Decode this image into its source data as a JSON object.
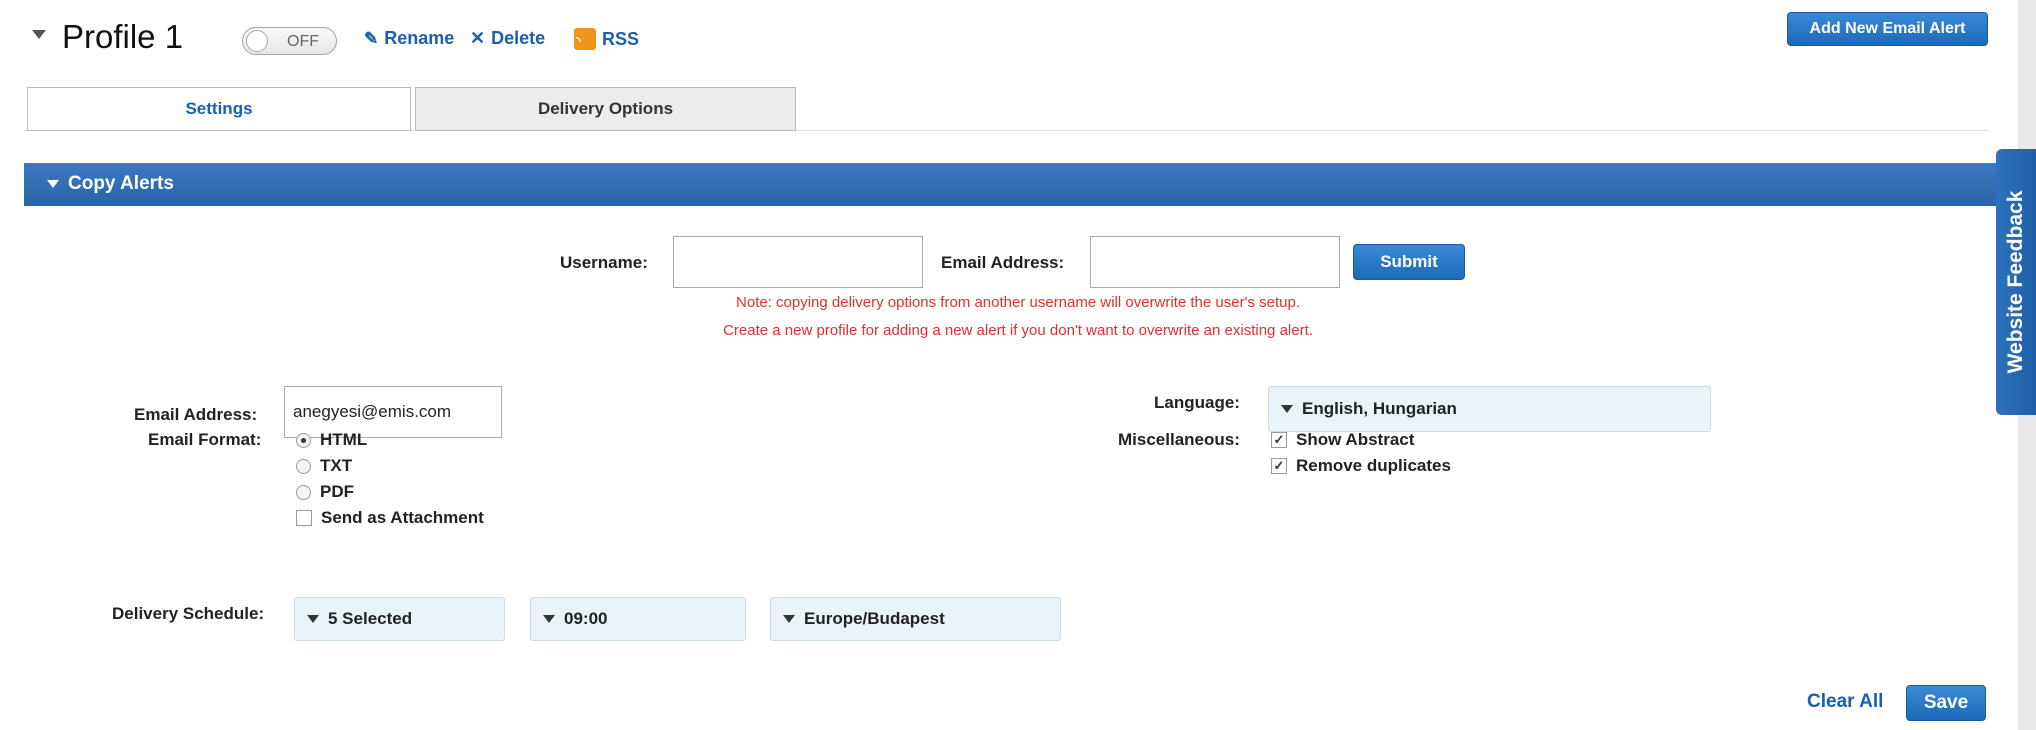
{
  "header": {
    "title": "Profile 1",
    "toggle_label": "OFF",
    "rename": "Rename",
    "delete": "Delete",
    "rss": "RSS",
    "add_alert": "Add New Email Alert"
  },
  "tabs": [
    {
      "label": "Settings",
      "active": true
    },
    {
      "label": "Delivery Options",
      "active": false
    }
  ],
  "section": {
    "title": "Copy Alerts"
  },
  "copy_form": {
    "username_label": "Username:",
    "username_value": "",
    "email_label": "Email Address:",
    "email_value": "",
    "submit": "Submit",
    "note_line1": "Note: copying delivery options from another username will overwrite the user's setup.",
    "note_line2": "Create a new profile for adding a new alert if you don't want to overwrite an existing alert."
  },
  "settings": {
    "email_label": "Email Address:",
    "email_value": "anegyesi@emis.com",
    "format_label": "Email Format:",
    "formats": [
      {
        "label": "HTML",
        "selected": true
      },
      {
        "label": "TXT",
        "selected": false
      },
      {
        "label": "PDF",
        "selected": false
      }
    ],
    "attachment_label": "Send as Attachment",
    "attachment_checked": false,
    "schedule_label": "Delivery Schedule:",
    "schedule_days": "5 Selected",
    "schedule_time": "09:00",
    "schedule_timezone": "Europe/Budapest",
    "language_label": "Language:",
    "language_value": "English, Hungarian",
    "misc_label": "Miscellaneous:",
    "misc_options": [
      {
        "label": "Show Abstract",
        "checked": true
      },
      {
        "label": "Remove duplicates",
        "checked": true
      }
    ]
  },
  "footer": {
    "clear_all": "Clear All",
    "save": "Save"
  },
  "feedback_tab": "Website Feedback",
  "colors": {
    "accent": "#2b65a9",
    "link": "#1a5fb0",
    "note": "#e03030"
  }
}
